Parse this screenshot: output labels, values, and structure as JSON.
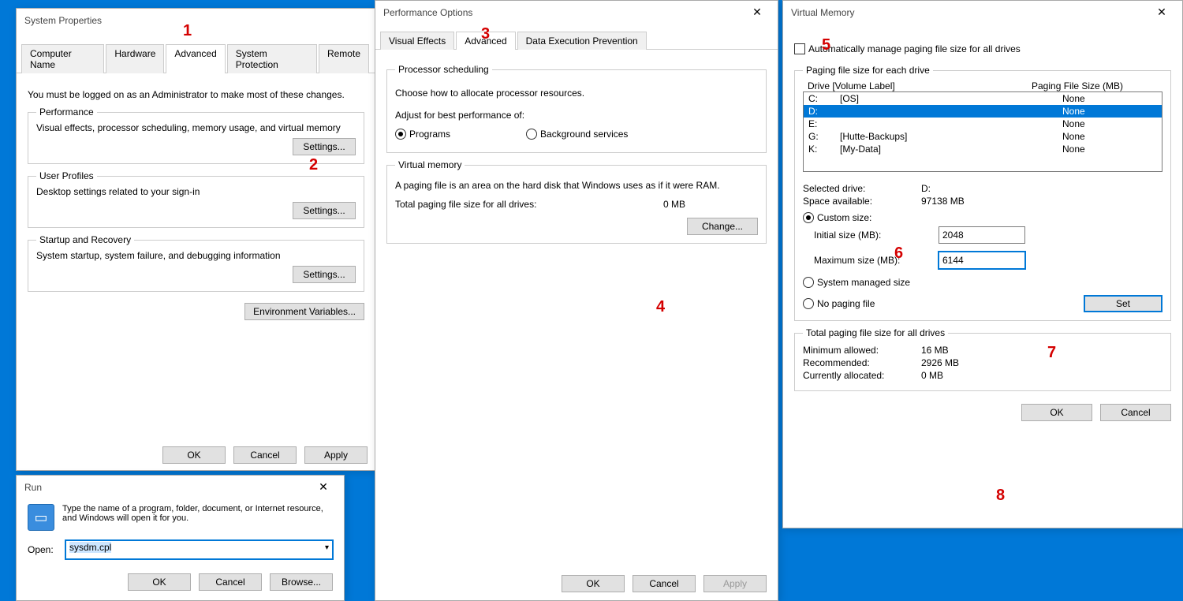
{
  "annotations": {
    "a1": "1",
    "a2": "2",
    "a3": "3",
    "a4": "4",
    "a5": "5",
    "a6": "6",
    "a7": "7",
    "a8": "8"
  },
  "sysprop": {
    "title": "System Properties",
    "tabs": [
      "Computer Name",
      "Hardware",
      "Advanced",
      "System Protection",
      "Remote"
    ],
    "adminNote": "You must be logged on as an Administrator to make most of these changes.",
    "perf": {
      "legend": "Performance",
      "desc": "Visual effects, processor scheduling, memory usage, and virtual memory",
      "btn": "Settings..."
    },
    "profiles": {
      "legend": "User Profiles",
      "desc": "Desktop settings related to your sign-in",
      "btn": "Settings..."
    },
    "startup": {
      "legend": "Startup and Recovery",
      "desc": "System startup, system failure, and debugging information",
      "btn": "Settings..."
    },
    "envbtn": "Environment Variables...",
    "ok": "OK",
    "cancel": "Cancel",
    "apply": "Apply"
  },
  "perfopt": {
    "title": "Performance Options",
    "tabs": [
      "Visual Effects",
      "Advanced",
      "Data Execution Prevention"
    ],
    "proc": {
      "legend": "Processor scheduling",
      "desc": "Choose how to allocate processor resources.",
      "adjust": "Adjust for best performance of:",
      "opt1": "Programs",
      "opt2": "Background services"
    },
    "vm": {
      "legend": "Virtual memory",
      "desc": "A paging file is an area on the hard disk that Windows uses as if it were RAM.",
      "totalLabel": "Total paging file size for all drives:",
      "totalVal": "0 MB",
      "btn": "Change..."
    },
    "ok": "OK",
    "cancel": "Cancel",
    "apply": "Apply"
  },
  "vmem": {
    "title": "Virtual Memory",
    "autoCheck": "Automatically manage paging file size for all drives",
    "pagingLegend": "Paging file size for each drive",
    "hdrDrive": "Drive  [Volume Label]",
    "hdrSize": "Paging File Size (MB)",
    "drives": [
      {
        "d": "C:",
        "lbl": "[OS]",
        "sz": "None",
        "sel": false
      },
      {
        "d": "D:",
        "lbl": "",
        "sz": "None",
        "sel": true
      },
      {
        "d": "E:",
        "lbl": "",
        "sz": "None",
        "sel": false
      },
      {
        "d": "G:",
        "lbl": "[Hutte-Backups]",
        "sz": "None",
        "sel": false
      },
      {
        "d": "K:",
        "lbl": "[My-Data]",
        "sz": "None",
        "sel": false
      }
    ],
    "selDriveLbl": "Selected drive:",
    "selDrive": "D:",
    "spaceLbl": "Space available:",
    "space": "97138 MB",
    "custom": "Custom size:",
    "initLbl": "Initial size (MB):",
    "initVal": "2048",
    "maxLbl": "Maximum size (MB):",
    "maxVal": "6144",
    "sysManaged": "System managed size",
    "noPaging": "No paging file",
    "setBtn": "Set",
    "totalLegend": "Total paging file size for all drives",
    "minLbl": "Minimum allowed:",
    "minVal": "16 MB",
    "recLbl": "Recommended:",
    "recVal": "2926 MB",
    "curLbl": "Currently allocated:",
    "curVal": "0 MB",
    "ok": "OK",
    "cancel": "Cancel"
  },
  "run": {
    "title": "Run",
    "desc": "Type the name of a program, folder, document, or Internet resource, and Windows will open it for you.",
    "openLbl": "Open:",
    "value": "sysdm.cpl",
    "ok": "OK",
    "cancel": "Cancel",
    "browse": "Browse..."
  }
}
